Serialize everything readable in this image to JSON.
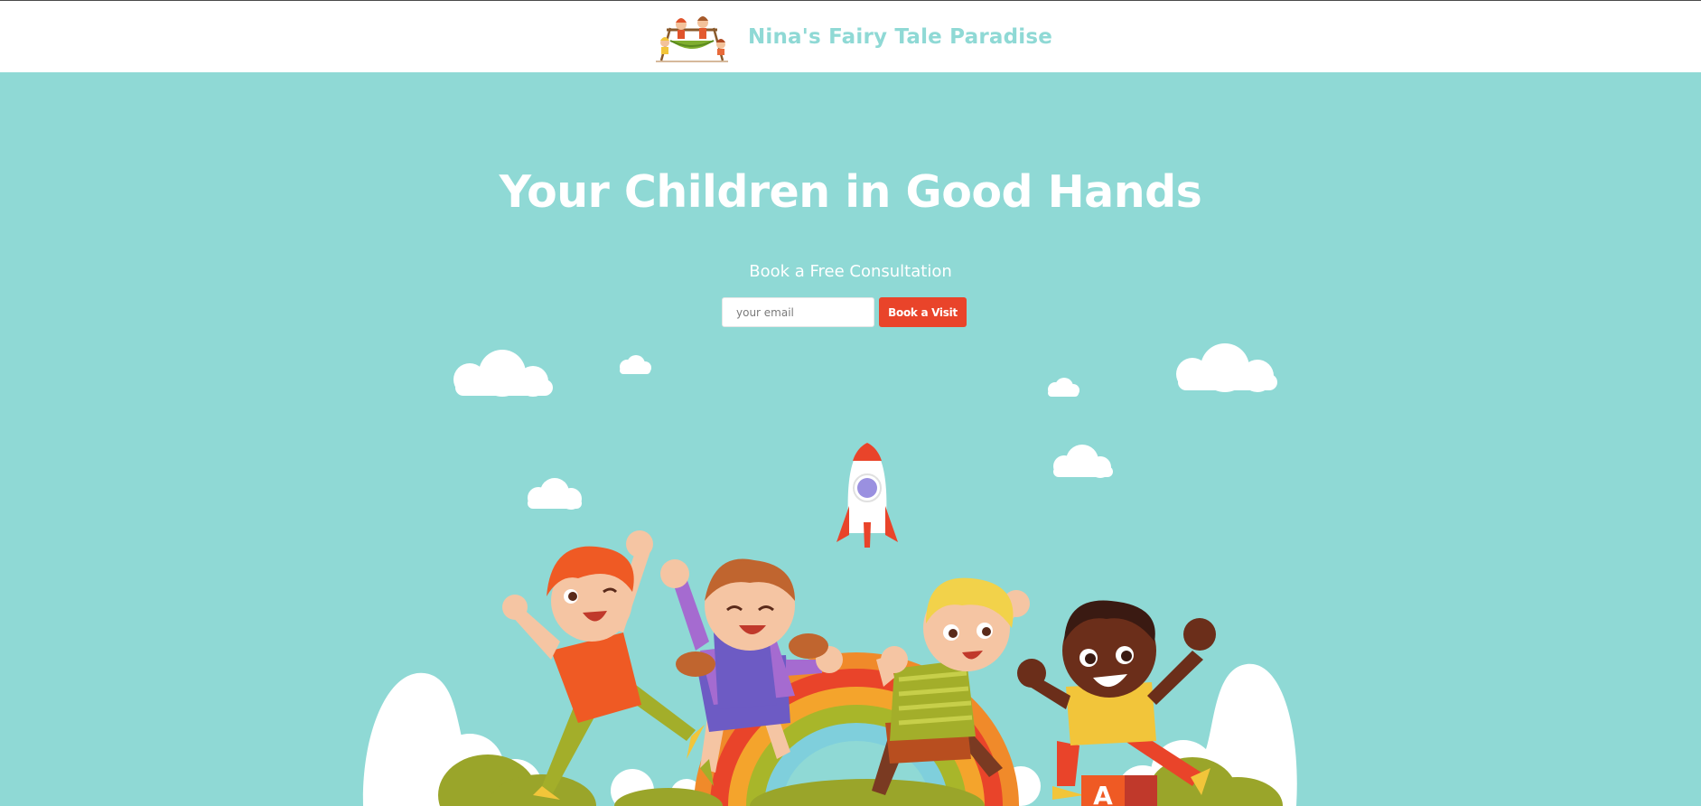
{
  "header": {
    "brand_name": "Nina's Fairy Tale Paradise",
    "logo_icon": "swing-kids-logo"
  },
  "hero": {
    "title": "Your Children in Good Hands",
    "subtitle": "Book a Free Consultation",
    "email_placeholder": "your email",
    "email_value": "",
    "button_label": "Book a Visit",
    "illustration_icon": "jumping-kids-rainbow-illustration",
    "block_letter": "A"
  },
  "colors": {
    "background": "#8fd9d5",
    "brand_text": "#8fd9d5",
    "button": "#e9442a",
    "header_bg": "#ffffff"
  }
}
